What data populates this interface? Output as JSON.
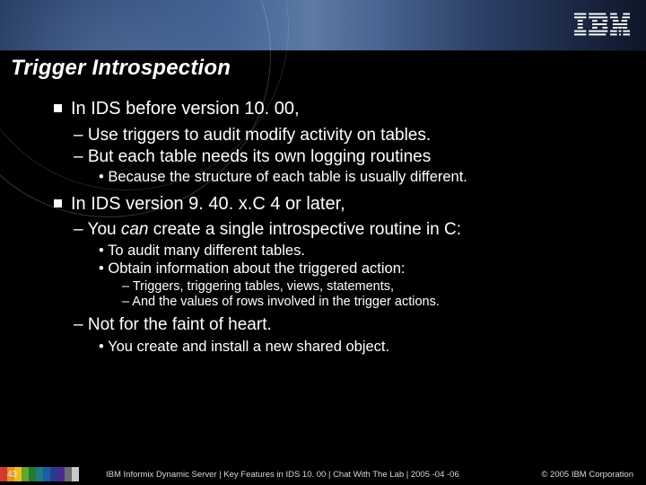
{
  "logo_name": "IBM",
  "title": "Trigger Introspection",
  "sections": [
    {
      "head": "In IDS before version 10. 00,",
      "l2": [
        {
          "text": "Use triggers to audit modify activity on tables."
        },
        {
          "text": "But each table needs its own logging routines",
          "l3": [
            {
              "text": "Because the structure of each table is usually different."
            }
          ]
        }
      ]
    },
    {
      "head": "In IDS version 9. 40. x.C 4 or later,",
      "l2": [
        {
          "text_pre": "You ",
          "text_em": "can",
          "text_post": " create a single introspective routine in C:",
          "l3": [
            {
              "text": "To audit many different tables."
            },
            {
              "text": "Obtain information about the triggered action:",
              "l4": [
                {
                  "text": "Triggers, triggering tables, views, statements,"
                },
                {
                  "text": "And the values of rows involved in the trigger actions."
                }
              ]
            }
          ]
        },
        {
          "text": "Not for the faint of heart.",
          "l3": [
            {
              "text": "You create and install a new shared object."
            }
          ]
        }
      ]
    }
  ],
  "footer": {
    "slide_no": "43",
    "left": "IBM Informix Dynamic Server | Key Features in IDS 10. 00  |  Chat With The Lab  |  2005 -04 -06",
    "right": "© 2005 IBM Corporation"
  },
  "chip_colors": [
    "#d23a2a",
    "#e98f1c",
    "#e7c21c",
    "#5fa62c",
    "#1f7a3a",
    "#1f7a85",
    "#1b5da6",
    "#2a3a8f",
    "#4a2a8f",
    "#6e6e6e",
    "#c9c9c9"
  ]
}
